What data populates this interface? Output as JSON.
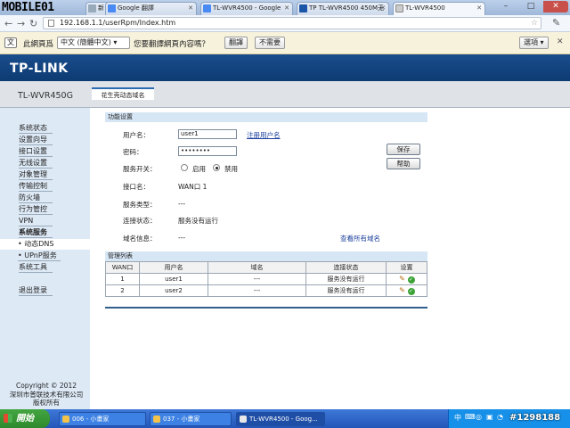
{
  "browser": {
    "brand_logo": "MOBILE01",
    "tabs": [
      {
        "label": "新",
        "icon": "page-icon"
      },
      {
        "label": "Google 翻譯",
        "icon": "google-icon"
      },
      {
        "label": "TL-WVR4500 - Google",
        "icon": "google-icon"
      },
      {
        "label": "TP TL-WVR4500 450M无",
        "icon": "tplink-icon"
      },
      {
        "label": "TL-WVR4500",
        "icon": "page-icon"
      }
    ],
    "window_buttons": [
      "–",
      "□",
      "✕"
    ],
    "url": "192.168.1.1/userRpm/Index.htm",
    "translate_bar": {
      "prefix": "此網頁爲",
      "language": "中文 (簡體中文)",
      "question": "您要翻譯網頁內容嗎？",
      "translate_button": "翻譯",
      "no_button": "不需要",
      "options_button": "選項"
    }
  },
  "router": {
    "brand": "TP-LINK",
    "model": "TL-WVR450G",
    "page_tab": "花生壳动态域名",
    "sidebar": [
      "系统状态",
      "设置向导",
      "接口设置",
      "无线设置",
      "对象管理",
      "传输控制",
      "防火墙",
      "行为管控",
      "VPN",
      "系统服务",
      "• 动态DNS",
      "• UPnP服务",
      "系统工具",
      "退出登录"
    ],
    "copyright": [
      "Copyright © 2012",
      "深圳市普联技术有限公司",
      "版权所有"
    ],
    "function_section": {
      "title": "功能设置",
      "username_label": "用户名：",
      "username_value": "user1",
      "register_link": "注册用户名",
      "password_label": "密码：",
      "password_value": "••••••••",
      "service_switch_label": "服务开关：",
      "enable_label": "启用",
      "disable_label": "禁用",
      "interface_label": "接口名：",
      "interface_value": "WAN口 1",
      "service_type_label": "服务类型：",
      "service_type_value": "---",
      "connection_label": "连接状态：",
      "connection_value": "服务没有运行",
      "domain_label": "域名信息：",
      "domain_value": "---",
      "view_domains_link": "查看所有域名",
      "save_button": "保存",
      "help_button": "帮助"
    },
    "management": {
      "title": "管理列表",
      "columns": [
        "WAN口",
        "用户名",
        "域名",
        "连接状态",
        "设置"
      ],
      "rows": [
        {
          "wan": "1",
          "user": "user1",
          "domain": "---",
          "status": "服务没有运行"
        },
        {
          "wan": "2",
          "user": "user2",
          "domain": "---",
          "status": "服务没有运行"
        }
      ]
    }
  },
  "taskbar": {
    "start_label": "開始",
    "tasks": [
      "006 - 小畫家",
      "037 - 小畫家",
      "TL-WVR4500 - Goog..."
    ],
    "tray_watermark": "#1298188"
  }
}
